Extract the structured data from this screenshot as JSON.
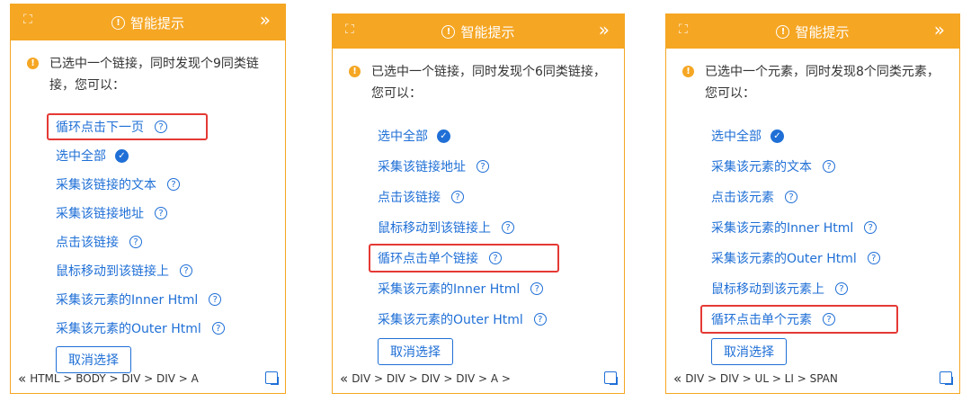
{
  "colors": {
    "accent": "#f5a623",
    "link": "#1f6fd6",
    "highlight": "#e53935"
  },
  "header": {
    "title": "智能提示",
    "left_icon": "expand-icon",
    "right_icon": "double-chevron-right-icon"
  },
  "panels": [
    {
      "message": "已选中一个链接，同时发现个9同类链接，您可以：",
      "items": [
        {
          "label": "循环点击下一页",
          "icon": "question-icon"
        },
        {
          "label": "选中全部",
          "icon": "check-icon"
        },
        {
          "label": "采集该链接的文本",
          "icon": "question-icon"
        },
        {
          "label": "采集该链接地址",
          "icon": "question-icon"
        },
        {
          "label": "点击该链接",
          "icon": "question-icon"
        },
        {
          "label": "鼠标移动到该链接上",
          "icon": "question-icon"
        },
        {
          "label": "采集该元素的Inner Html",
          "icon": "question-icon"
        },
        {
          "label": "采集该元素的Outer Html",
          "icon": "question-icon"
        }
      ],
      "cancel": "取消选择",
      "breadcrumb": "HTML > BODY > DIV > DIV > A"
    },
    {
      "message": "已选中一个链接，同时发现个6同类链接，您可以：",
      "items": [
        {
          "label": "选中全部",
          "icon": "check-icon"
        },
        {
          "label": "采集该链接地址",
          "icon": "question-icon"
        },
        {
          "label": "点击该链接",
          "icon": "question-icon"
        },
        {
          "label": "鼠标移动到该链接上",
          "icon": "question-icon"
        },
        {
          "label": "循环点击单个链接",
          "icon": "question-icon"
        },
        {
          "label": "采集该元素的Inner Html",
          "icon": "question-icon"
        },
        {
          "label": "采集该元素的Outer Html",
          "icon": "question-icon"
        }
      ],
      "cancel": "取消选择",
      "breadcrumb": "DIV > DIV > DIV > DIV > A >"
    },
    {
      "message": "已选中一个元素，同时发现8个同类元素，您可以：",
      "items": [
        {
          "label": "选中全部",
          "icon": "check-icon"
        },
        {
          "label": "采集该元素的文本",
          "icon": "question-icon"
        },
        {
          "label": "点击该元素",
          "icon": "question-icon"
        },
        {
          "label": "采集该元素的Inner Html",
          "icon": "question-icon"
        },
        {
          "label": "采集该元素的Outer Html",
          "icon": "question-icon"
        },
        {
          "label": "鼠标移动到该元素上",
          "icon": "question-icon"
        },
        {
          "label": "循环点击单个元素",
          "icon": "question-icon"
        }
      ],
      "cancel": "取消选择",
      "breadcrumb": "DIV > DIV > UL > LI > SPAN"
    }
  ]
}
